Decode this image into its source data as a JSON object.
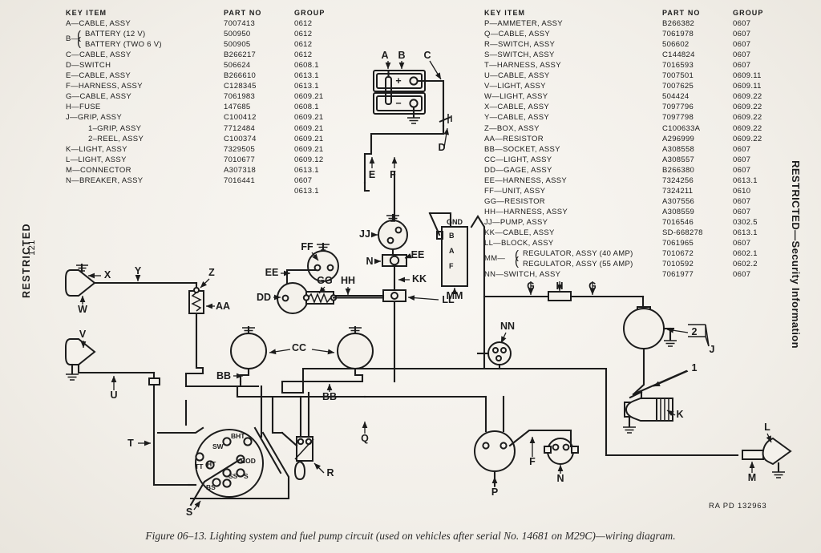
{
  "document": {
    "classification_left": "RESTRICTED",
    "classification_right": "RESTRICTED—Security Information",
    "page_number": "121",
    "figure_caption": "Figure 06–13. Lighting system and fuel pump circuit (used on vehicles after serial No. 14681 on M29C)—wiring diagram.",
    "drawing_number": "RA PD  132963"
  },
  "tables": {
    "headers": {
      "key": "KEY      ITEM",
      "part": "PART  NO",
      "group": "GROUP"
    },
    "left": [
      {
        "key": "A—CABLE, ASSY",
        "part": "7007413",
        "group": "0612"
      },
      {
        "key": "BATTERY (12 V)",
        "part": "500950",
        "group": "0612",
        "brace": "first",
        "brace_key": "B—"
      },
      {
        "key": "BATTERY (TWO 6 V)",
        "part": "500905",
        "group": "0612",
        "brace": "second"
      },
      {
        "key": "C—CABLE, ASSY",
        "part": "B266217",
        "group": "0612"
      },
      {
        "key": "D—SWITCH",
        "part": "506624",
        "group": "0608.1"
      },
      {
        "key": "E—CABLE, ASSY",
        "part": "B266610",
        "group": "0613.1"
      },
      {
        "key": "F—HARNESS, ASSY",
        "part": "C128345",
        "group": "0613.1"
      },
      {
        "key": "G—CABLE, ASSY",
        "part": "7061983",
        "group": "0609.21"
      },
      {
        "key": "H—FUSE",
        "part": "147685",
        "group": "0608.1"
      },
      {
        "key": "J—GRIP, ASSY",
        "part": "C100412",
        "group": "0609.21"
      },
      {
        "key": "1–GRIP, ASSY",
        "part": "7712484",
        "group": "0609.21",
        "indent": true
      },
      {
        "key": "2–REEL, ASSY",
        "part": "C100374",
        "group": "0609.21",
        "indent": true
      },
      {
        "key": "K—LIGHT, ASSY",
        "part": "7329505",
        "group": "0609.21"
      },
      {
        "key": "L—LIGHT, ASSY",
        "part": "7010677",
        "group": "0609.12"
      },
      {
        "key": "M—CONNECTOR",
        "part": "A307318",
        "group": "0613.1"
      },
      {
        "key": "N—BREAKER, ASSY",
        "part": "7016441",
        "group": "0607"
      },
      {
        "key": "",
        "part": "",
        "group": "0613.1"
      }
    ],
    "right": [
      {
        "key": "P—AMMETER, ASSY",
        "part": "B266382",
        "group": "0607"
      },
      {
        "key": "Q—CABLE, ASSY",
        "part": "7061978",
        "group": "0607"
      },
      {
        "key": "R—SWITCH, ASSY",
        "part": "506602",
        "group": "0607"
      },
      {
        "key": "S—SWITCH, ASSY",
        "part": "C144824",
        "group": "0607"
      },
      {
        "key": "T—HARNESS, ASSY",
        "part": "7016593",
        "group": "0607"
      },
      {
        "key": "U—CABLE, ASSY",
        "part": "7007501",
        "group": "0609.11"
      },
      {
        "key": "V—LIGHT, ASSY",
        "part": "7007625",
        "group": "0609.11"
      },
      {
        "key": "W—LIGHT, ASSY",
        "part": "504424",
        "group": "0609.22"
      },
      {
        "key": "X—CABLE, ASSY",
        "part": "7097796",
        "group": "0609.22"
      },
      {
        "key": "Y—CABLE, ASSY",
        "part": "7097798",
        "group": "0609.22"
      },
      {
        "key": "Z—BOX, ASSY",
        "part": "C100633A",
        "group": "0609.22"
      },
      {
        "key": "AA—RESISTOR",
        "part": "A296999",
        "group": "0609.22"
      },
      {
        "key": "BB—SOCKET, ASSY",
        "part": "A308558",
        "group": "0607"
      },
      {
        "key": "CC—LIGHT, ASSY",
        "part": "A308557",
        "group": "0607"
      },
      {
        "key": "DD—GAGE, ASSY",
        "part": "B266380",
        "group": "0607"
      },
      {
        "key": "EE—HARNESS, ASSY",
        "part": "7324256",
        "group": "0613.1"
      },
      {
        "key": "FF—UNIT, ASSY",
        "part": "7324211",
        "group": "0610"
      },
      {
        "key": "GG—RESISTOR",
        "part": "A307556",
        "group": "0607"
      },
      {
        "key": "HH—HARNESS, ASSY",
        "part": "A308559",
        "group": "0607"
      },
      {
        "key": "JJ—PUMP, ASSY",
        "part": "7016546",
        "group": "0302.5"
      },
      {
        "key": "KK—CABLE, ASSY",
        "part": "SD-668278",
        "group": "0613.1"
      },
      {
        "key": "LL—BLOCK, ASSY",
        "part": "7061965",
        "group": "0607"
      },
      {
        "key": "REGULATOR, ASSY (40 AMP)",
        "part": "7010672",
        "group": "0602.1",
        "brace": "first",
        "brace_key": "MM—"
      },
      {
        "key": "REGULATOR, ASSY (55 AMP)",
        "part": "7010592",
        "group": "0602.2",
        "brace": "second"
      },
      {
        "key": "NN—SWITCH, ASSY",
        "part": "7061977",
        "group": "0607"
      }
    ]
  },
  "diagram": {
    "battery_box": {
      "positive": "+",
      "negative": "−"
    },
    "regulator_terminals": [
      "GND",
      "B",
      "A",
      "F"
    ],
    "light_switch_terminals": [
      "BHT",
      "SW",
      "TT",
      "BOD",
      "HT",
      "SS",
      "S",
      "BS"
    ],
    "callouts": [
      "A",
      "B",
      "C",
      "D",
      "E",
      "F",
      "G",
      "H",
      "J",
      "K",
      "L",
      "M",
      "N",
      "P",
      "Q",
      "R",
      "S",
      "T",
      "U",
      "V",
      "W",
      "X",
      "Y",
      "Z",
      "AA",
      "BB",
      "CC",
      "DD",
      "EE",
      "FF",
      "GG",
      "HH",
      "JJ",
      "KK",
      "LL",
      "MM",
      "NN",
      "1",
      "2"
    ]
  }
}
